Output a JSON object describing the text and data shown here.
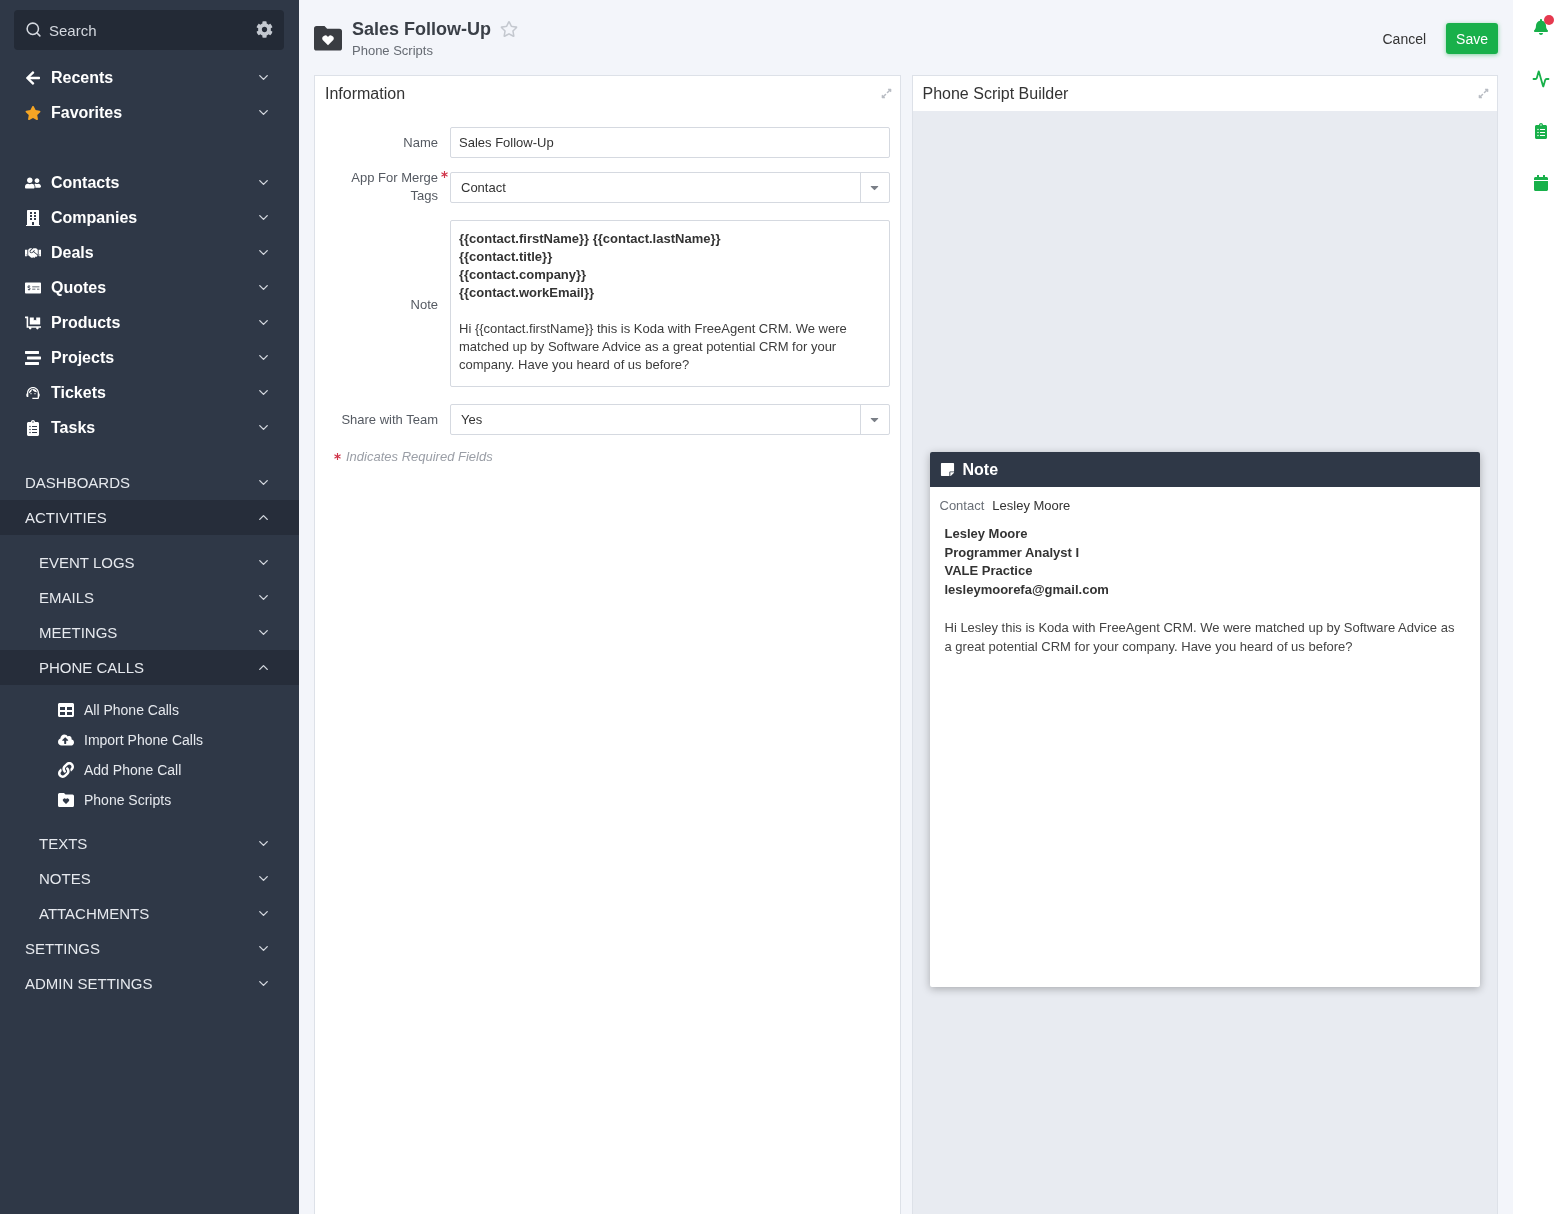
{
  "sidebar": {
    "search": {
      "placeholder": "Search"
    },
    "shortcuts": [
      {
        "label": "Recents",
        "expanded": false
      },
      {
        "label": "Favorites",
        "expanded": false
      }
    ],
    "apps": [
      {
        "label": "Contacts",
        "expanded": false
      },
      {
        "label": "Companies",
        "expanded": false
      },
      {
        "label": "Deals",
        "expanded": false
      },
      {
        "label": "Quotes",
        "expanded": false
      },
      {
        "label": "Products",
        "expanded": false
      },
      {
        "label": "Projects",
        "expanded": false
      },
      {
        "label": "Tickets",
        "expanded": false
      },
      {
        "label": "Tasks",
        "expanded": false
      }
    ],
    "sections": [
      {
        "label": "DASHBOARDS",
        "expanded": false
      },
      {
        "label": "ACTIVITIES",
        "expanded": true,
        "children": [
          {
            "label": "EVENT LOGS",
            "expanded": false
          },
          {
            "label": "EMAILS",
            "expanded": false
          },
          {
            "label": "MEETINGS",
            "expanded": false
          },
          {
            "label": "PHONE CALLS",
            "expanded": true,
            "children": [
              {
                "label": "All Phone Calls"
              },
              {
                "label": "Import Phone Calls"
              },
              {
                "label": "Add Phone Call"
              },
              {
                "label": "Phone Scripts"
              }
            ]
          },
          {
            "label": "TEXTS",
            "expanded": false
          },
          {
            "label": "NOTES",
            "expanded": false
          },
          {
            "label": "ATTACHMENTS",
            "expanded": false
          }
        ]
      },
      {
        "label": "SETTINGS",
        "expanded": false
      },
      {
        "label": "ADMIN SETTINGS",
        "expanded": false
      }
    ]
  },
  "header": {
    "title": "Sales Follow-Up",
    "subtitle": "Phone Scripts",
    "favorite": false,
    "actions": [
      {
        "label": "Cancel",
        "kind": "link"
      },
      {
        "label": "Save",
        "kind": "primary"
      }
    ]
  },
  "information": {
    "title": "Information",
    "fields": [
      {
        "kind": "text",
        "label": "Name",
        "value": "Sales Follow-Up",
        "required": false
      },
      {
        "kind": "select",
        "label": "App For Merge Tags",
        "value": "Contact",
        "required": true
      },
      {
        "kind": "note",
        "label": "Note",
        "merge_tags": [
          "{{contact.firstName}} {{contact.lastName}}",
          "{{contact.title}}",
          "{{contact.company}}",
          "{{contact.workEmail}}"
        ],
        "body": "Hi {{contact.firstName}} this is Koda with FreeAgent CRM. We were matched up by Software Advice as a great potential CRM for your company. Have you heard of us before?",
        "required": false
      },
      {
        "kind": "select",
        "label": "Share with Team",
        "value": "Yes",
        "required": false
      }
    ],
    "required_note": "Indicates Required Fields"
  },
  "builder": {
    "title": "Phone Script Builder",
    "preview": {
      "title": "Note",
      "contact_label": "Contact",
      "contact_value": "Lesley Moore",
      "details": [
        "Lesley Moore",
        "Programmer Analyst I",
        "VALE Practice",
        "lesleymoorefa@gmail.com"
      ],
      "body": "Hi Lesley this is Koda with FreeAgent CRM. We were matched up by Software Advice as a great potential CRM for your company. Have you heard of us before?"
    }
  },
  "right_rail": {
    "unread_alerts": true
  }
}
